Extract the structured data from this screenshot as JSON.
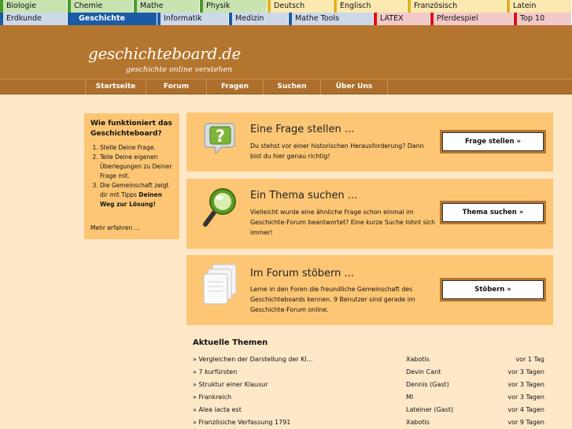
{
  "sites_row1": [
    {
      "label": "Biologie",
      "color": "#c9e4b0",
      "mark": "#4a9a2a"
    },
    {
      "label": "Chemie",
      "color": "#c9e4b0",
      "mark": "#4a9a2a"
    },
    {
      "label": "Mathe",
      "color": "#c9e4b0",
      "mark": "#4a9a2a"
    },
    {
      "label": "Physik",
      "color": "#c9e4b0",
      "mark": "#4a9a2a"
    },
    {
      "label": "Deutsch",
      "color": "#fbe9b0",
      "mark": "#e2b21c"
    },
    {
      "label": "Englisch",
      "color": "#fbe9b0",
      "mark": "#e2b21c"
    },
    {
      "label": "Französisch",
      "color": "#fbe9b0",
      "mark": "#e2b21c"
    },
    {
      "label": "Latein",
      "color": "#fbe9b0",
      "mark": "#e2b21c"
    }
  ],
  "sites_row2": [
    {
      "label": "Erdkunde",
      "color": "#cdd8ea",
      "mark": "#1a5ba6"
    },
    {
      "label": "Geschichte",
      "color": "#1a5ba6",
      "mark": "#1a5ba6",
      "active": true
    },
    {
      "label": "Informatik",
      "color": "#cdd8ea",
      "mark": "#1a5ba6"
    },
    {
      "label": "Medizin",
      "color": "#cdd8ea",
      "mark": "#1a5ba6"
    },
    {
      "label": "Mathe Tools",
      "color": "#cdd8ea",
      "mark": "#1a5ba6"
    },
    {
      "label": "LATEX",
      "color": "#f2c9c9",
      "mark": "#d11"
    },
    {
      "label": "Pferdespiel",
      "color": "#f2c9c9",
      "mark": "#d11"
    },
    {
      "label": "Top 10",
      "color": "#f2c9c9",
      "mark": "#d11"
    }
  ],
  "logo": {
    "main": "geschichteboard.de",
    "sub": "geschichte online verstehen"
  },
  "nav": [
    "Startseite",
    "Forum",
    "Fragen",
    "Suchen",
    "Über Uns"
  ],
  "sidebar": {
    "title": "Wie funktioniert das Geschichteboard?",
    "steps": [
      "Stelle Deine Frage.",
      "Teile Deine eigenen Überlegungen zu Deiner Frage mit.",
      "Die Gemeinschaft zeigt dir mit Tipps Deinen Weg zur Lösung!"
    ],
    "more": "Mehr erfahren ..."
  },
  "panels": [
    {
      "icon": "question-icon",
      "title": "Eine Frage stellen ...",
      "text": "Du stehst vor einer historischen Herausforderung? Dann bist du hier genau richtig!",
      "button": "Frage stellen »"
    },
    {
      "icon": "magnifier-icon",
      "title": "Ein Thema suchen ...",
      "text": "Vielleicht wurde eine ähnliche Frage schon einmal im Geschichte-Forum beantwortet? Eine kurze Suche lohnt sich immer!",
      "button": "Thema suchen »"
    },
    {
      "icon": "documents-icon",
      "title": "Im Forum stöbern ...",
      "text": "Lerne in den Foren die freundliche Gemeinschaft des Geschichteboards kennen. 9 Benutzer sind gerade im Geschichte-Forum online.",
      "button": "Stöbern »"
    }
  ],
  "themen": {
    "heading": "Aktuelle Themen",
    "rows": [
      {
        "title": "» Vergleichen der Darstellung der Kl...",
        "author": "Xabotis",
        "date": "vor 1 Tag"
      },
      {
        "title": "» 7 kurfürsten",
        "author": "Devin Cant",
        "date": "vor 3 Tagen"
      },
      {
        "title": "» Struktur einer Klausur",
        "author": "Dennis (Gast)",
        "date": "vor 3 Tagen"
      },
      {
        "title": "» Frankreich",
        "author": "MI",
        "date": "vor 3 Tagen"
      },
      {
        "title": "» Alea iacta est",
        "author": "Lateiner (Gast)",
        "date": "vor 4 Tagen"
      },
      {
        "title": "» Französiche Verfassung 1791",
        "author": "Xabotis",
        "date": "vor 9 Tagen"
      }
    ]
  }
}
